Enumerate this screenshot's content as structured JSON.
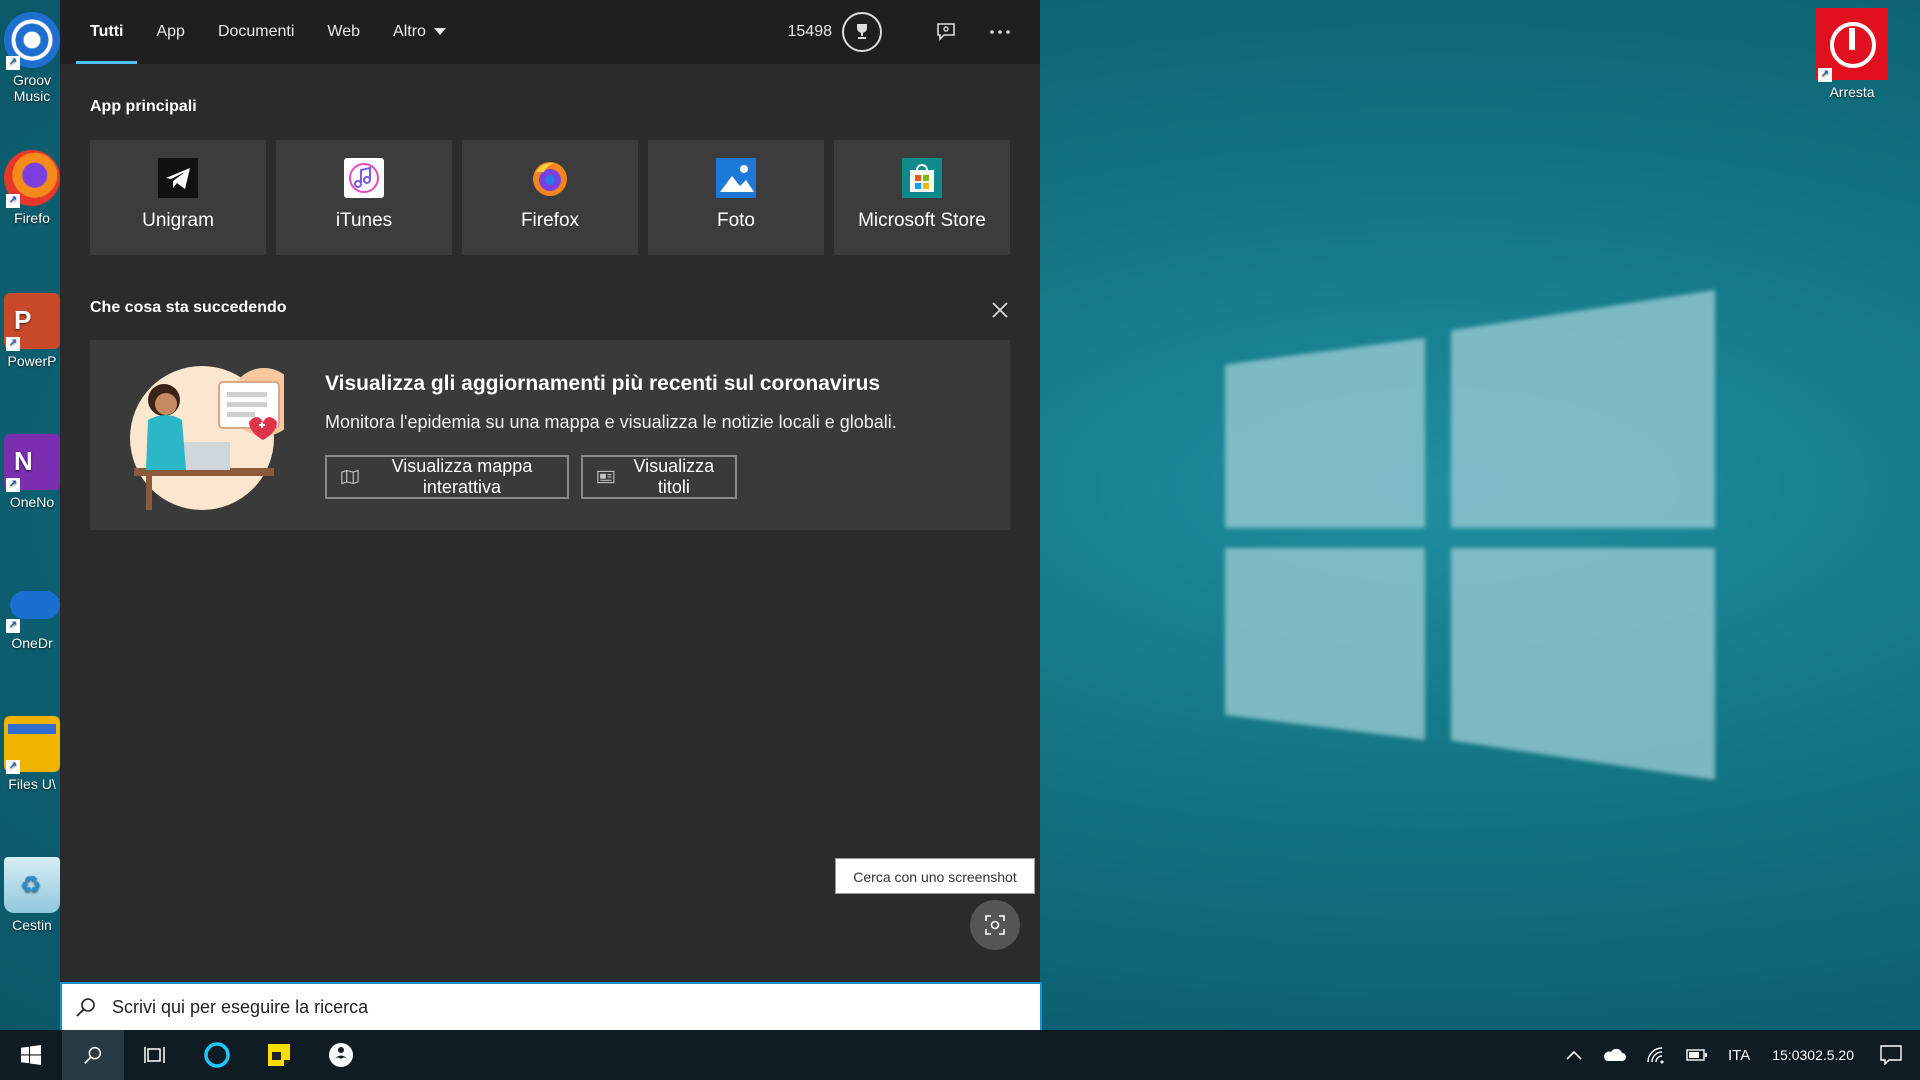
{
  "tabs": [
    {
      "label": "Tutti",
      "active": true
    },
    {
      "label": "App"
    },
    {
      "label": "Documenti"
    },
    {
      "label": "Web"
    },
    {
      "label": "Altro",
      "dropdown": true
    }
  ],
  "rewards": {
    "points": "15498",
    "icon": "trophy-icon"
  },
  "top_apps": {
    "title": "App principali",
    "items": [
      {
        "label": "Unigram",
        "icon": "unigram-icon"
      },
      {
        "label": "iTunes",
        "icon": "itunes-icon"
      },
      {
        "label": "Firefox",
        "icon": "firefox-icon"
      },
      {
        "label": "Foto",
        "icon": "photos-icon"
      },
      {
        "label": "Microsoft Store",
        "icon": "store-icon"
      }
    ]
  },
  "news": {
    "section_title": "Che cosa sta succedendo",
    "title": "Visualizza gli aggiornamenti più recenti sul coronavirus",
    "subtitle": "Monitora l'epidemia su una mappa e visualizza le notizie locali e globali.",
    "button_map": "Visualizza mappa interattiva",
    "button_headlines": "Visualizza titoli"
  },
  "screenshot_search": {
    "tooltip": "Cerca con uno screenshot"
  },
  "search": {
    "placeholder": "Scrivi qui per eseguire la ricerca"
  },
  "desktop_left_icons": [
    {
      "label": "Groov Music",
      "line1": "Groov",
      "line2": "Music",
      "color": "#1f6fd0"
    },
    {
      "label": "Firefo",
      "line1": "Firefo",
      "color": "#e8582a"
    },
    {
      "label": "PowerP",
      "line1": "PowerP",
      "color": "#c94a2a"
    },
    {
      "label": "OneNo",
      "line1": "OneNo",
      "color": "#7b2fb0"
    },
    {
      "label": "OneDr",
      "line1": "OneDr",
      "color": "#1a6fd0"
    },
    {
      "label": "Files U",
      "line1": "Files U\\",
      "color": "#f0b400"
    },
    {
      "label": "Cestin",
      "line1": "Cestin",
      "color": "#5fb0d0"
    }
  ],
  "desktop_right_icon": {
    "label": "Arresta",
    "color": "#e0101e"
  },
  "tray": {
    "language": "ITA",
    "time": "15:03",
    "date": "02.5.20"
  }
}
